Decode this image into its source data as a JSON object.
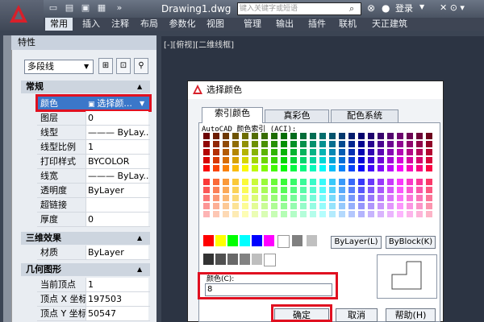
{
  "app": {
    "doc_title": "Drawing1.dwg",
    "search_placeholder": "键入关键字或短语",
    "login": "登录"
  },
  "ribbon": {
    "tabs": [
      "常用",
      "插入",
      "注释",
      "布局",
      "参数化",
      "视图",
      "管理",
      "输出",
      "插件",
      "联机",
      "天正建筑"
    ]
  },
  "viewport": {
    "label": "[-][俯视][二维线框]"
  },
  "properties": {
    "title": "特性",
    "object_type": "多段线",
    "sections": [
      {
        "title": "常规",
        "rows": [
          {
            "key": "颜色",
            "value": "选择颜..."
          },
          {
            "key": "图层",
            "value": "0"
          },
          {
            "key": "线型",
            "value": "——— ByLay..."
          },
          {
            "key": "线型比例",
            "value": "1"
          },
          {
            "key": "打印样式",
            "value": "BYCOLOR"
          },
          {
            "key": "线宽",
            "value": "——— ByLay..."
          },
          {
            "key": "透明度",
            "value": "ByLayer"
          },
          {
            "key": "超链接",
            "value": ""
          },
          {
            "key": "厚度",
            "value": "0"
          }
        ]
      },
      {
        "title": "三维效果",
        "rows": [
          {
            "key": "材质",
            "value": "ByLayer"
          }
        ]
      },
      {
        "title": "几何图形",
        "rows": [
          {
            "key": "当前顶点",
            "value": "1"
          },
          {
            "key": "顶点 X 坐标",
            "value": "197503"
          },
          {
            "key": "顶点 Y 坐标",
            "value": "50547"
          }
        ]
      }
    ]
  },
  "dialog": {
    "title": "选择颜色",
    "tabs": [
      "索引颜色",
      "真彩色",
      "配色系统"
    ],
    "aci_label": "AutoCAD 颜色索引 (ACI):",
    "bylayer": "ByLayer(L)",
    "byblock": "ByBlock(K)",
    "color_label": "颜色(C):",
    "color_value": "8",
    "ok": "确定",
    "cancel": "取消",
    "help": "帮助(H)"
  }
}
